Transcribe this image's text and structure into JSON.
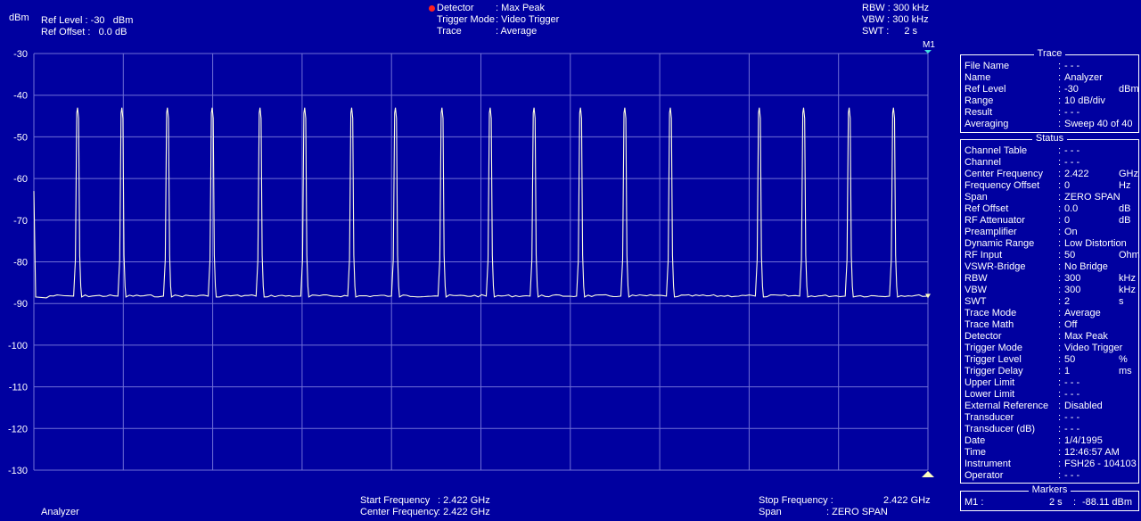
{
  "header": {
    "y_unit": "dBm",
    "ref_level_label": "Ref Level :",
    "ref_level_value": "-30",
    "ref_level_unit": "dBm",
    "ref_offset_label": "Ref Offset :",
    "ref_offset_value": "0.0 dB",
    "detector_label": "Detector",
    "detector_value": ": Max Peak",
    "trigger_mode_label": "Trigger Mode",
    "trigger_mode_value": ": Video Trigger",
    "trace_label": "Trace",
    "trace_value": ": Average",
    "rbw": "RBW : 300 kHz",
    "vbw": "VBW : 300 kHz",
    "swt_label": "SWT :",
    "swt_value": "2 s",
    "marker_tag": "M1"
  },
  "footer": {
    "mode": "Analyzer",
    "start_label": "Start Frequency",
    "start_value": ": 2.422 GHz",
    "center_label": "Center Frequency",
    "center_value": ": 2.422 GHz",
    "stop_label": "Stop Frequency :",
    "stop_value": "2.422 GHz",
    "span_label": "Span",
    "span_value": ": ZERO SPAN"
  },
  "trace_panel": {
    "title": "Trace",
    "rows": [
      {
        "key": "File Name",
        "sep": ":",
        "value": "- - -",
        "unit": ""
      },
      {
        "key": "Name",
        "sep": ":",
        "value": "Analyzer",
        "unit": ""
      },
      {
        "key": "Ref Level",
        "sep": ":",
        "value": "-30",
        "unit": "dBm"
      },
      {
        "key": "Range",
        "sep": ":",
        "value": "10 dB/div",
        "unit": ""
      },
      {
        "key": "Result",
        "sep": ":",
        "value": "- - -",
        "unit": ""
      },
      {
        "key": "Averaging",
        "sep": ":",
        "value": "Sweep 40 of 40",
        "unit": ""
      }
    ]
  },
  "status_panel": {
    "title": "Status",
    "rows": [
      {
        "key": "Channel Table",
        "sep": ":",
        "value": "- - -",
        "unit": ""
      },
      {
        "key": "Channel",
        "sep": ":",
        "value": "- - -",
        "unit": ""
      },
      {
        "key": "Center Frequency",
        "sep": ":",
        "value": "2.422",
        "unit": "GHz"
      },
      {
        "key": "Frequency Offset",
        "sep": ":",
        "value": "0",
        "unit": "Hz"
      },
      {
        "key": "Span",
        "sep": ":",
        "value": "ZERO SPAN",
        "unit": ""
      },
      {
        "key": "Ref Offset",
        "sep": ":",
        "value": "0.0",
        "unit": "dB"
      },
      {
        "key": "RF Attenuator",
        "sep": ":",
        "value": "0",
        "unit": "dB"
      },
      {
        "key": "Preamplifier",
        "sep": ":",
        "value": "On",
        "unit": ""
      },
      {
        "key": "Dynamic Range",
        "sep": ":",
        "value": "Low Distortion",
        "unit": ""
      },
      {
        "key": "RF Input",
        "sep": ":",
        "value": "50",
        "unit": "Ohm"
      },
      {
        "key": "VSWR-Bridge",
        "sep": ":",
        "value": "No Bridge",
        "unit": ""
      },
      {
        "key": "RBW",
        "sep": ":",
        "value": "300",
        "unit": "kHz"
      },
      {
        "key": "VBW",
        "sep": ":",
        "value": "300",
        "unit": "kHz"
      },
      {
        "key": "SWT",
        "sep": ":",
        "value": "2",
        "unit": "s"
      },
      {
        "key": "Trace Mode",
        "sep": ":",
        "value": "Average",
        "unit": ""
      },
      {
        "key": "Trace Math",
        "sep": ":",
        "value": "Off",
        "unit": ""
      },
      {
        "key": "Detector",
        "sep": ":",
        "value": "Max Peak",
        "unit": ""
      },
      {
        "key": "Trigger Mode",
        "sep": ":",
        "value": "Video Trigger",
        "unit": ""
      },
      {
        "key": "Trigger Level",
        "sep": ":",
        "value": "50",
        "unit": "%"
      },
      {
        "key": "Trigger Delay",
        "sep": ":",
        "value": "1",
        "unit": "ms"
      },
      {
        "key": "Upper Limit",
        "sep": ":",
        "value": "- - -",
        "unit": ""
      },
      {
        "key": "Lower Limit",
        "sep": ":",
        "value": "- - -",
        "unit": ""
      },
      {
        "key": "External Reference",
        "sep": ":",
        "value": "Disabled",
        "unit": ""
      },
      {
        "key": "Transducer",
        "sep": ":",
        "value": "- - -",
        "unit": ""
      },
      {
        "key": "Transducer (dB)",
        "sep": ":",
        "value": "- - -",
        "unit": ""
      },
      {
        "key": "Date",
        "sep": ":",
        "value": "1/4/1995",
        "unit": ""
      },
      {
        "key": "Time",
        "sep": ":",
        "value": "12:46:57 AM",
        "unit": ""
      },
      {
        "key": "Instrument",
        "sep": ":",
        "value": "FSH26 - 104103",
        "unit": ""
      },
      {
        "key": "Operator",
        "sep": ":",
        "value": "- - -",
        "unit": ""
      }
    ]
  },
  "markers_panel": {
    "title": "Markers",
    "m1_name": "M1 :",
    "m1_x": "2 s",
    "m1_sep": ":",
    "m1_y": "-88.11 dBm"
  },
  "colors": {
    "background": "#0000a0",
    "grid": "#6f6fd6",
    "trace": "#ffffe0",
    "marker": "#ffffc0",
    "detector_dot": "#ff2020"
  },
  "chart_data": {
    "type": "line",
    "ylabel": "dBm",
    "ylim": [
      -130,
      -30
    ],
    "y_ticks": [
      "-30",
      "-40",
      "-50",
      "-60",
      "-70",
      "-80",
      "-90",
      "-100",
      "-110",
      "-120",
      "-130"
    ],
    "xlim": [
      0,
      2
    ],
    "x_unit": "s",
    "grid": true,
    "baseline_dbm": -88,
    "peak_dbm": -43,
    "pulse_centers_s": [
      0.099,
      0.198,
      0.3,
      0.4,
      0.507,
      0.607,
      0.712,
      0.81,
      0.914,
      1.022,
      1.12,
      1.224,
      1.323,
      1.425,
      1.624,
      1.723,
      1.825,
      1.924
    ],
    "marker": {
      "name": "M1",
      "x_s": 2,
      "y_dbm": -88.11
    }
  }
}
